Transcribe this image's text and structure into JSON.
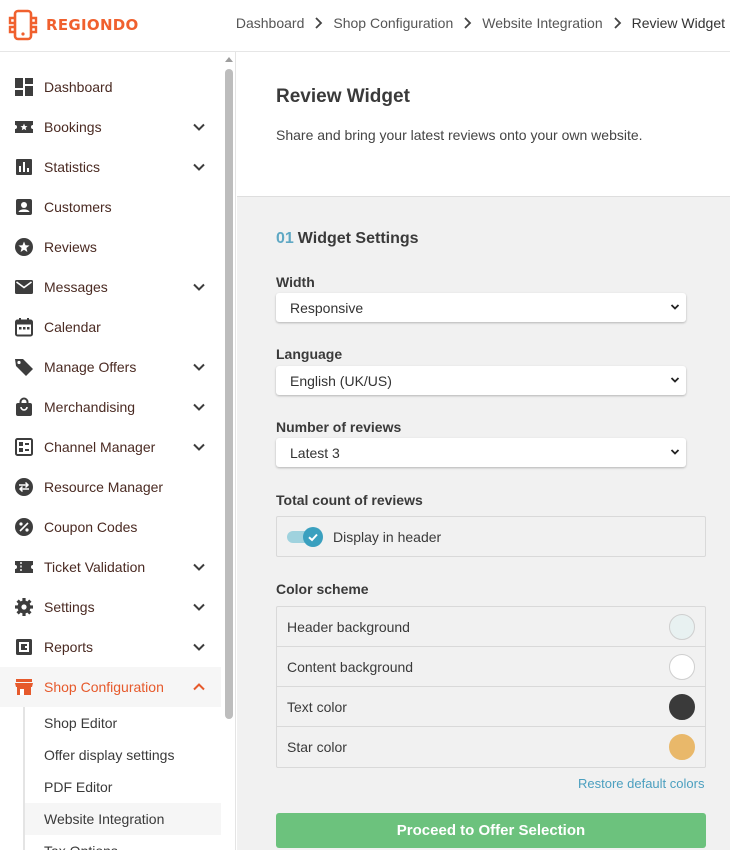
{
  "brand": {
    "name": "REGIONDO",
    "color": "#f0602e"
  },
  "breadcrumb": [
    "Dashboard",
    "Shop Configuration",
    "Website Integration",
    "Review Widget"
  ],
  "sidebar": {
    "items": [
      {
        "label": "Dashboard",
        "icon": "dashboard-icon",
        "expandable": false
      },
      {
        "label": "Bookings",
        "icon": "ticket-star-icon",
        "expandable": true
      },
      {
        "label": "Statistics",
        "icon": "bar-chart-icon",
        "expandable": true
      },
      {
        "label": "Customers",
        "icon": "contact-card-icon",
        "expandable": false
      },
      {
        "label": "Reviews",
        "icon": "star-circle-icon",
        "expandable": false
      },
      {
        "label": "Messages",
        "icon": "mail-icon",
        "expandable": true
      },
      {
        "label": "Calendar",
        "icon": "calendar-icon",
        "expandable": false
      },
      {
        "label": "Manage Offers",
        "icon": "tag-icon",
        "expandable": true
      },
      {
        "label": "Merchandising",
        "icon": "shopping-bag-icon",
        "expandable": true
      },
      {
        "label": "Channel Manager",
        "icon": "channel-grid-icon",
        "expandable": true
      },
      {
        "label": "Resource Manager",
        "icon": "swap-circle-icon",
        "expandable": false
      },
      {
        "label": "Coupon Codes",
        "icon": "percent-circle-icon",
        "expandable": false
      },
      {
        "label": "Ticket Validation",
        "icon": "ticket-icon",
        "expandable": true
      },
      {
        "label": "Settings",
        "icon": "gear-icon",
        "expandable": true
      },
      {
        "label": "Reports",
        "icon": "report-icon",
        "expandable": true
      },
      {
        "label": "Shop Configuration",
        "icon": "storefront-icon",
        "expandable": true,
        "active": true
      }
    ],
    "sub_items": [
      "Shop Editor",
      "Offer display settings",
      "PDF Editor",
      "Website Integration",
      "Tax Options"
    ],
    "active_sub": "Website Integration"
  },
  "page": {
    "title": "Review Widget",
    "description": "Share and bring your latest reviews onto your own website."
  },
  "widget_settings": {
    "step": "01",
    "title": "Widget Settings",
    "width": {
      "label": "Width",
      "value": "Responsive"
    },
    "language": {
      "label": "Language",
      "value": "English (UK/US)"
    },
    "num_reviews": {
      "label": "Number of reviews",
      "value": "Latest 3"
    },
    "total_count": {
      "label": "Total count of reviews",
      "toggle_label": "Display in header",
      "enabled": true
    },
    "color_scheme": {
      "label": "Color scheme",
      "rows": [
        {
          "label": "Header background",
          "color": "#e8f1f1"
        },
        {
          "label": "Content background",
          "color": "#ffffff"
        },
        {
          "label": "Text color",
          "color": "#3a3a3a"
        },
        {
          "label": "Star color",
          "color": "#e9b86a"
        }
      ]
    },
    "restore_label": "Restore default colors",
    "proceed_label": "Proceed to Offer Selection"
  },
  "colors": {
    "accent": "#e65a2c",
    "link": "#4b9fbf",
    "proceed": "#6cc27d",
    "toggle": "#3aa0bf",
    "step_number": "#5fa8c4"
  }
}
